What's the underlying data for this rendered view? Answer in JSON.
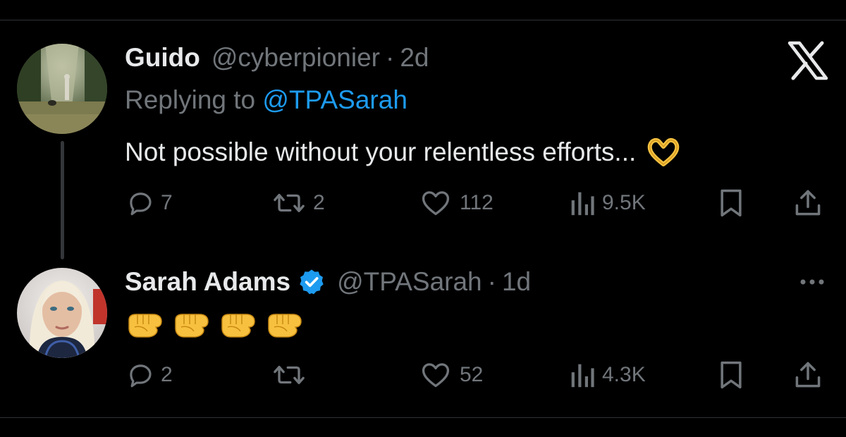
{
  "tweets": [
    {
      "name": "Guido",
      "handle": "@cyberpionier",
      "separator": "·",
      "time": "2d",
      "replying_prefix": "Replying to ",
      "replying_to": "@TPASarah",
      "text": "Not possible without your relentless efforts...",
      "text_emoji": "heart-hands",
      "stats": {
        "replies": "7",
        "reposts": "2",
        "likes": "112",
        "views": "9.5K"
      }
    },
    {
      "name": "Sarah Adams",
      "verified": true,
      "handle": "@TPASarah",
      "separator": "·",
      "time": "1d",
      "text_emoji": [
        "fist-bump",
        "fist-bump",
        "fist-bump",
        "fist-bump"
      ],
      "stats": {
        "replies": "2",
        "reposts": "",
        "likes": "52",
        "views": "4.3K"
      }
    }
  ],
  "colors": {
    "background": "#000000",
    "primary_text": "#e7e9ea",
    "secondary_text": "#71767b",
    "accent": "#1d9bf0",
    "divider": "#2f3336"
  },
  "icons": [
    "x-logo-icon",
    "more-icon",
    "reply-icon",
    "repost-icon",
    "like-icon",
    "views-icon",
    "bookmark-icon",
    "share-icon",
    "verified-badge-icon"
  ]
}
